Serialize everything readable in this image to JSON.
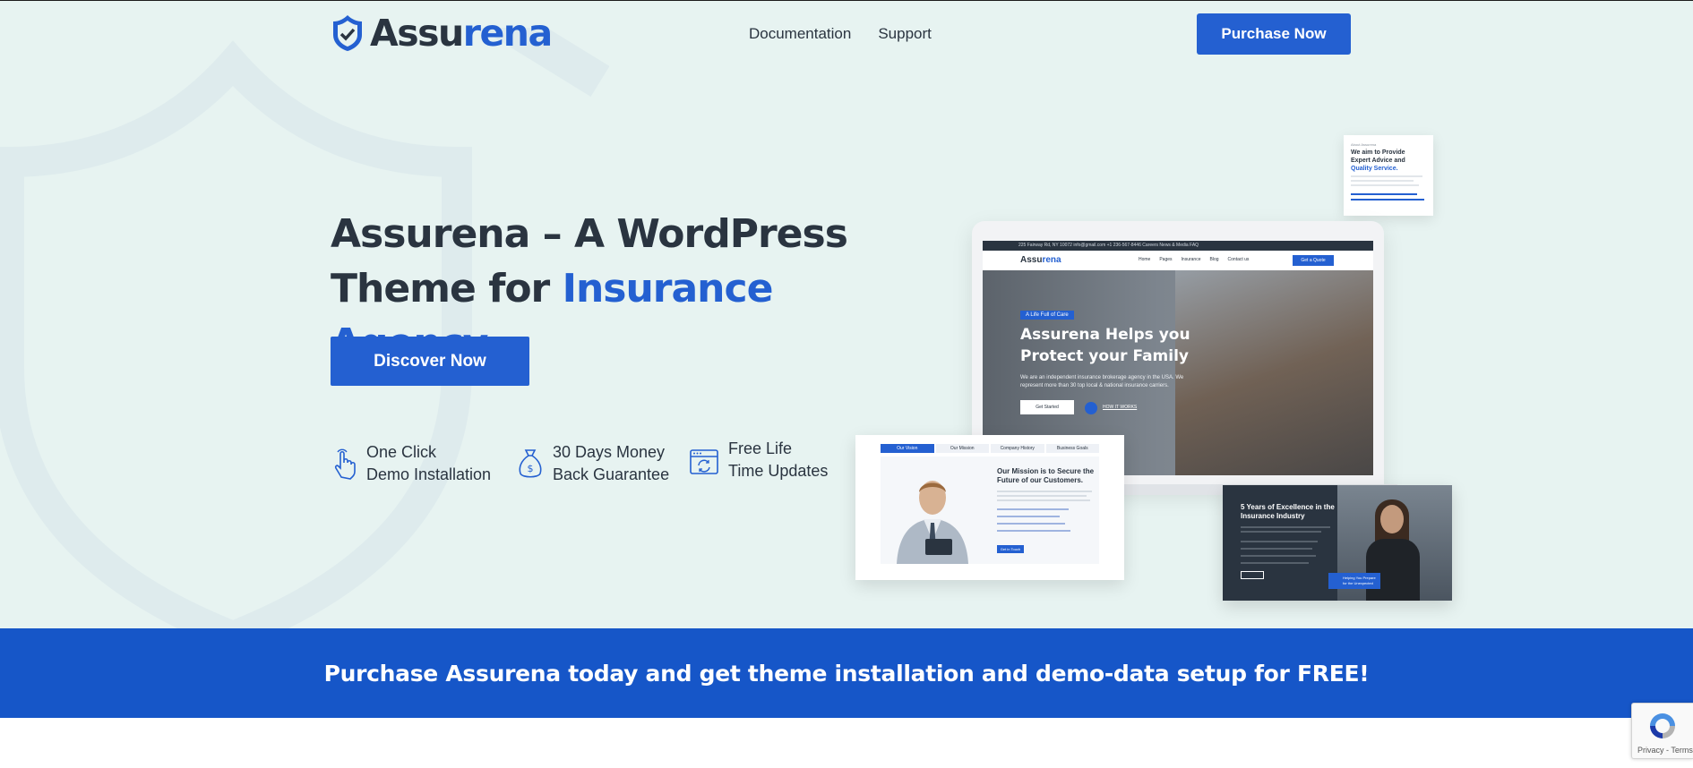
{
  "brand": {
    "logo_part1": "Assu",
    "logo_part2": "rena",
    "accent_color": "#2460d1",
    "dark_text_color": "#2a3440",
    "hero_bg_color": "#e7f3f1",
    "banner_color": "#1656c8"
  },
  "nav": {
    "items": [
      {
        "label": "Documentation"
      },
      {
        "label": "Support"
      }
    ],
    "purchase_label": "Purchase Now"
  },
  "hero": {
    "headline_line1": "Assurena – A WordPress",
    "headline_line2_plain": "Theme for ",
    "headline_line2_accent": "Insurance Agency.",
    "cta_label": "Discover Now"
  },
  "features": [
    {
      "icon": "pointer-hand-icon",
      "line1": "One Click",
      "line2": "Demo Installation"
    },
    {
      "icon": "money-bag-icon",
      "line1": "30 Days Money",
      "line2": "Back Guarantee"
    },
    {
      "icon": "browser-update-icon",
      "line1": "Free Life",
      "line2": "Time Updates"
    }
  ],
  "mockup": {
    "topbar": "225 Fairway Rd, NY 10072    info@gmail.com    +1 236-567-8446        Careers   News & Media   FAQ",
    "site_logo_part1": "Assu",
    "site_logo_part2": "rena",
    "menu": [
      "Home",
      "Pages",
      "Insurance",
      "Blog",
      "Contact us"
    ],
    "quote_label": "Get a Quote",
    "badge": "A Life Full of Care",
    "heading": "Assurena Helps you Protect your Family",
    "text": "We are an independent insurance brokerage agency in the USA. We represent more than 30 top local & national insurance carriers.",
    "started_label": "Get Started",
    "how_label": "HOW IT WORKS",
    "card_top_small": "About Assurena",
    "card_top_title": "We aim to Provide Expert Advice and ",
    "card_top_title_accent": "Quality Service.",
    "mission_tabs": [
      "Our Vision",
      "Our Mission",
      "Company History",
      "Business Goals"
    ],
    "mission_title": "Our Mission is to Secure the Future of our Customers.",
    "mission_btn": "Get in Touch",
    "dark_title": "5 Years of Excellence in the Insurance Industry",
    "dark_btn": "Learn More",
    "dark_badge": "Helping You Prepare for the Unexpected"
  },
  "banner": {
    "text": "Purchase Assurena today and get theme installation and demo-data setup for FREE!"
  },
  "recaptcha": {
    "text": "Privacy - Terms"
  }
}
